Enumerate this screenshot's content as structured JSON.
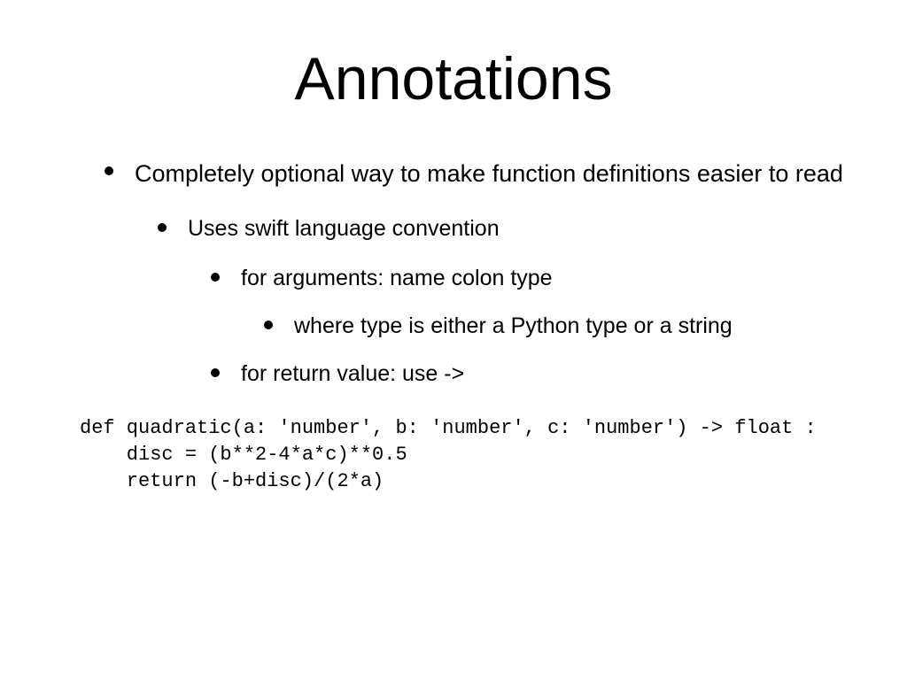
{
  "slide": {
    "title": "Annotations",
    "bullets": {
      "l1": "Completely optional way to make function definitions easier to read",
      "l2": "Uses swift language convention",
      "l3a": "for arguments:    name colon type",
      "l4": "where type is either a Python type or a string",
      "l3b": "for return value:  use ->"
    },
    "code": "def quadratic(a: 'number', b: 'number', c: 'number') -> float :\n    disc = (b**2-4*a*c)**0.5\n    return (-b+disc)/(2*a)"
  }
}
